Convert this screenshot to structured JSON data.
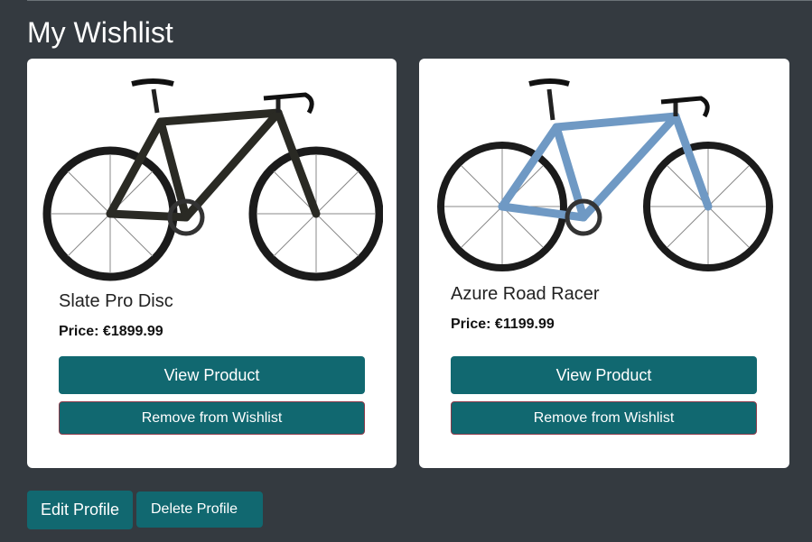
{
  "page": {
    "title": "My Wishlist"
  },
  "wishlist": {
    "items": [
      {
        "name": "Slate Pro Disc",
        "price": "Price: €1899.99",
        "view_label": "View Product",
        "remove_label": "Remove from Wishlist",
        "image": "black-road-bike"
      },
      {
        "name": "Azure Road Racer",
        "price": "Price: €1199.99",
        "view_label": "View Product",
        "remove_label": "Remove from Wishlist",
        "image": "blue-road-bike"
      }
    ]
  },
  "profile": {
    "edit_label": "Edit Profile",
    "delete_label": "Delete Profile"
  },
  "colors": {
    "background": "#343a40",
    "button": "#116870",
    "card": "#ffffff"
  }
}
